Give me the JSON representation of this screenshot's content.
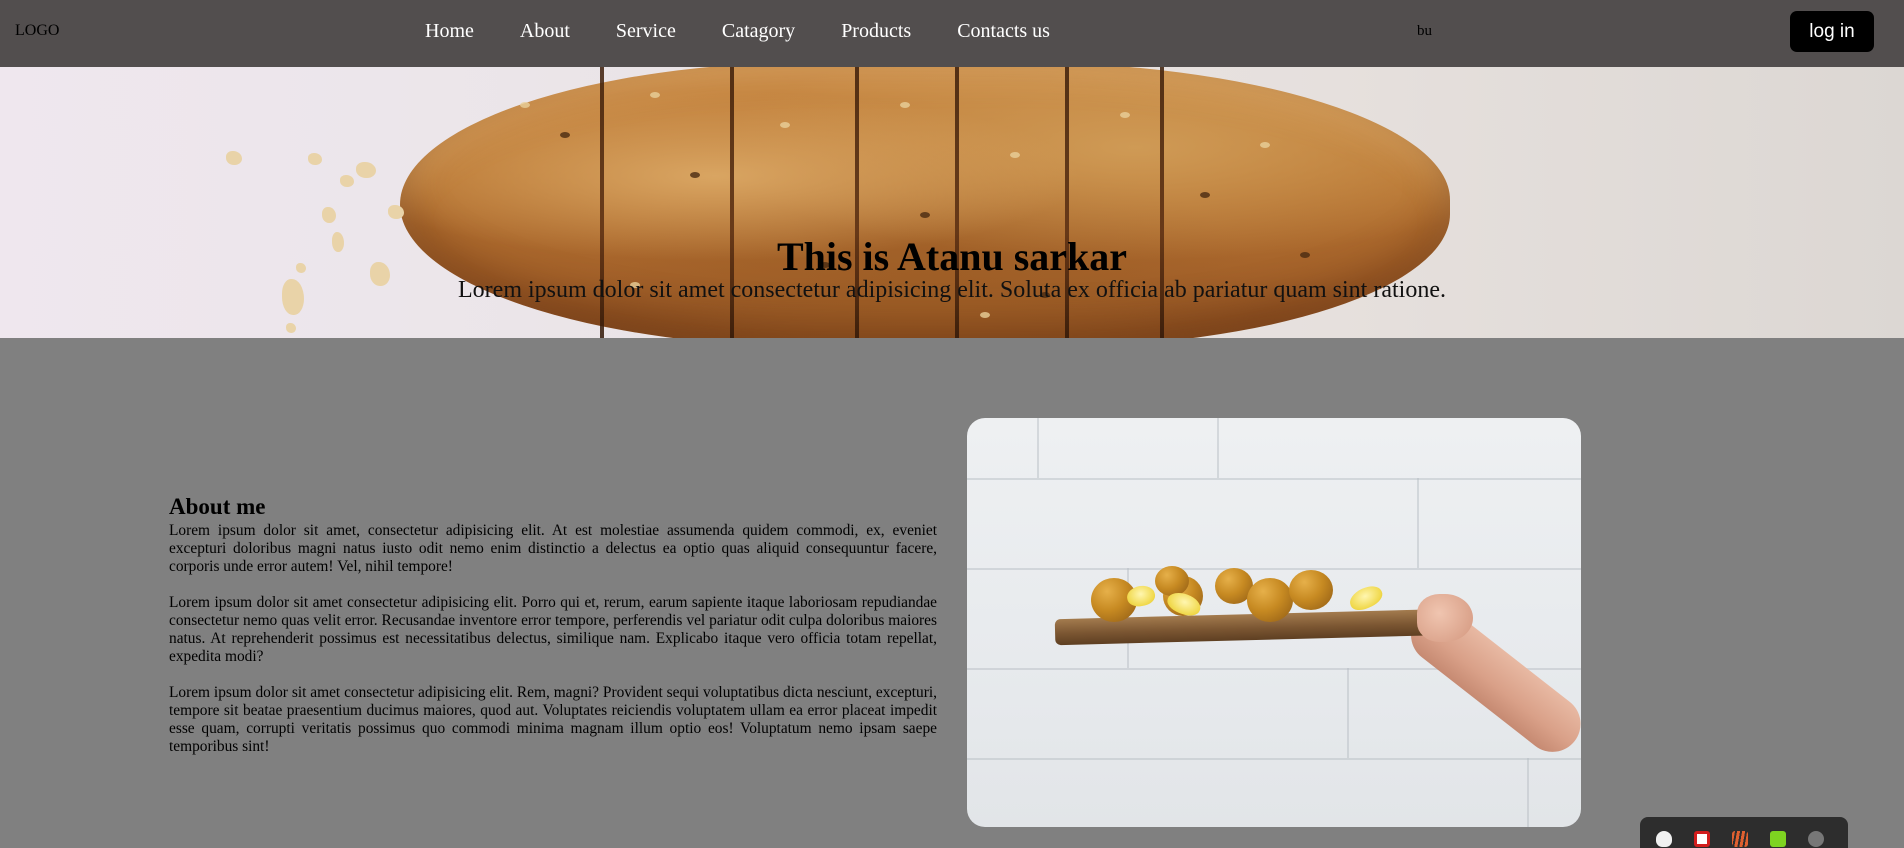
{
  "nav": {
    "logo": "LOGO",
    "links": [
      "Home",
      "About",
      "Service",
      "Catagory",
      "Products",
      "Contacts us"
    ],
    "user_tag": "bu",
    "login_label": "log in"
  },
  "hero": {
    "title": "This is Atanu sarkar",
    "subtitle": "Lorem ipsum dolor sit amet consectetur adipisicing elit. Soluta ex officia ab pariatur quam sint ratione."
  },
  "about": {
    "heading": "About me",
    "paragraphs": [
      "Lorem ipsum dolor sit amet, consectetur adipisicing elit. At est molestiae assumenda quidem commodi, ex, eveniet excepturi doloribus magni natus iusto odit nemo enim distinctio a delectus ea optio quas aliquid consequuntur facere, corporis unde error autem! Vel, nihil tempore!",
      "Lorem ipsum dolor sit amet consectetur adipisicing elit. Porro qui et, rerum, earum sapiente itaque laboriosam repudiandae consectetur nemo quas velit error. Recusandae inventore error tempore, perferendis vel pariatur odit culpa doloribus maiores natus. At reprehenderit possimus est necessitatibus delectus, similique nam. Explicabo itaque vero officia totam repellat, expedita modi?",
      "Lorem ipsum dolor sit amet consectetur adipisicing elit. Rem, magni? Provident sequi voluptatibus dicta nesciunt, excepturi, tempore sit beatae praesentium ducimus maiores, quod aut. Voluptates reiciendis voluptatem ullam ea error placeat impedit esse quam, corrupti veritatis possimus quo commodi minima magnam illum optio eos! Voluptatum nemo ipsam saepe temporibus sint!"
    ]
  },
  "photo": {
    "subject": "hand holding wooden board with fried balls and lemon wedges"
  },
  "tray": {
    "icons": [
      "discord-icon",
      "pdf-icon",
      "stripes-app-icon",
      "green-app-icon",
      "settings-icon"
    ]
  },
  "colors": {
    "navbar": "#524e4e",
    "page_background": "#808080",
    "login_button": "#000000",
    "nav_text": "#ffffff"
  }
}
